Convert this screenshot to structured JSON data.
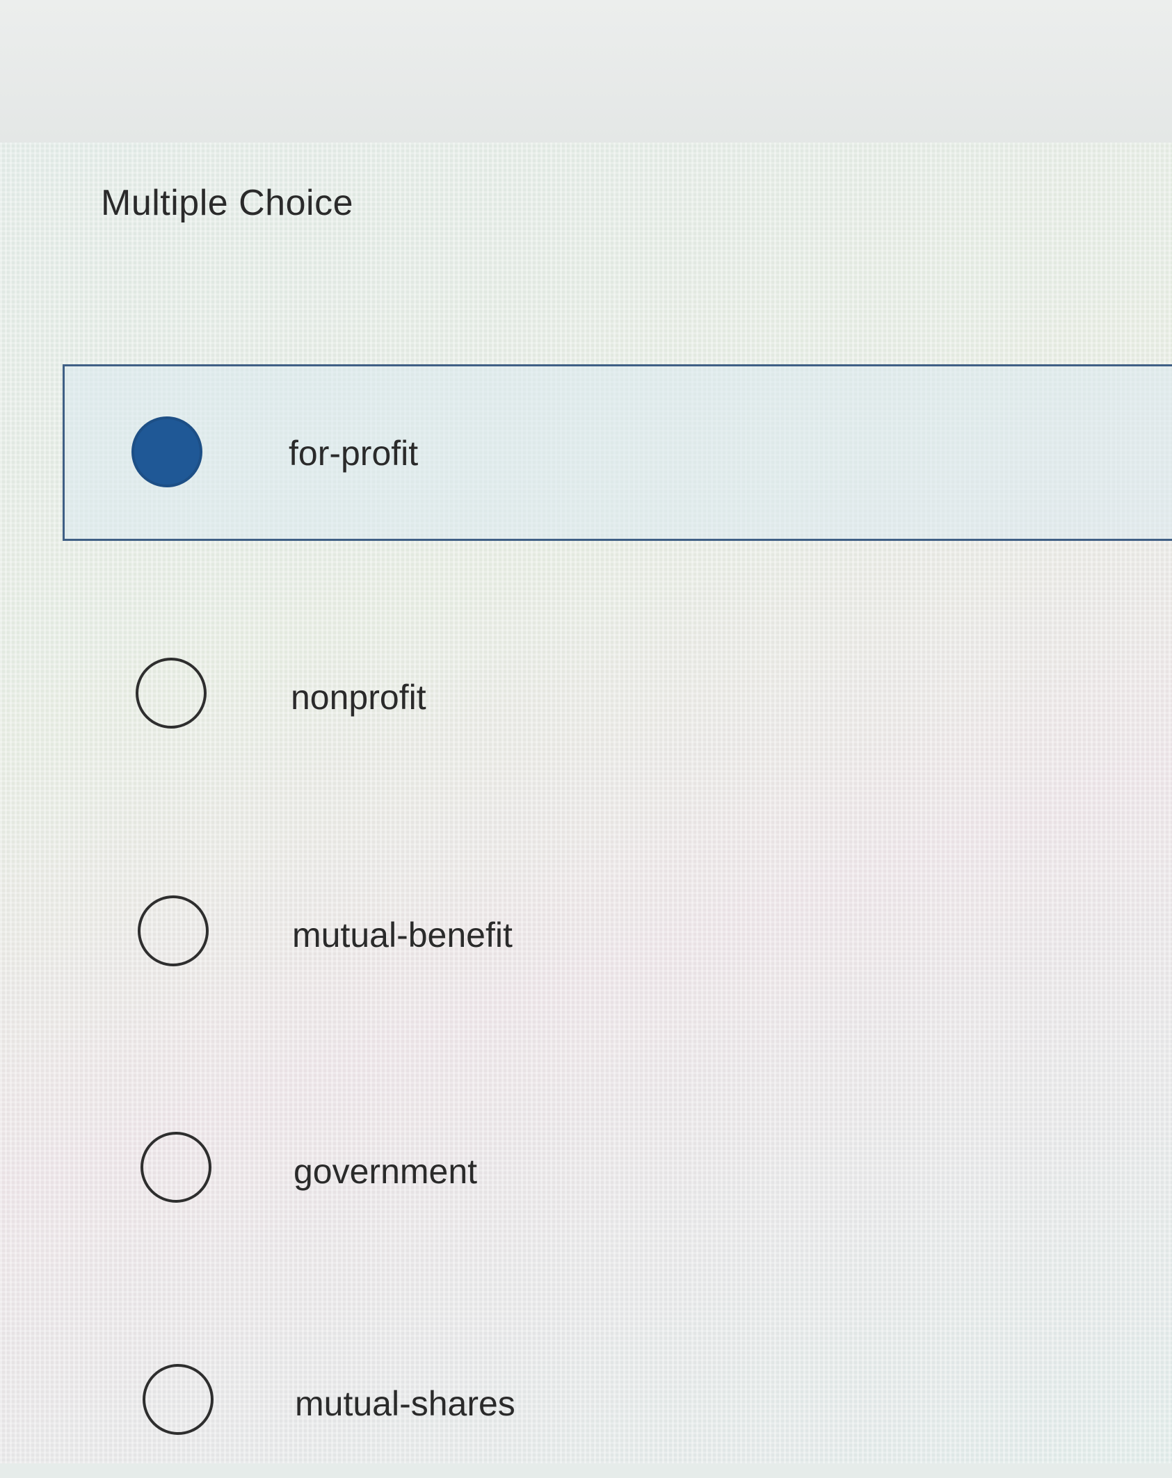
{
  "question": {
    "heading": "Multiple Choice"
  },
  "options": [
    {
      "label": "for-profit",
      "selected": true
    },
    {
      "label": "nonprofit",
      "selected": false
    },
    {
      "label": "mutual-benefit",
      "selected": false
    },
    {
      "label": "government",
      "selected": false
    },
    {
      "label": "mutual-shares",
      "selected": false
    }
  ],
  "colors": {
    "selected_fill": "#1f5896",
    "selected_border": "#3f5f85",
    "radio_outline": "#2e2e2e"
  }
}
